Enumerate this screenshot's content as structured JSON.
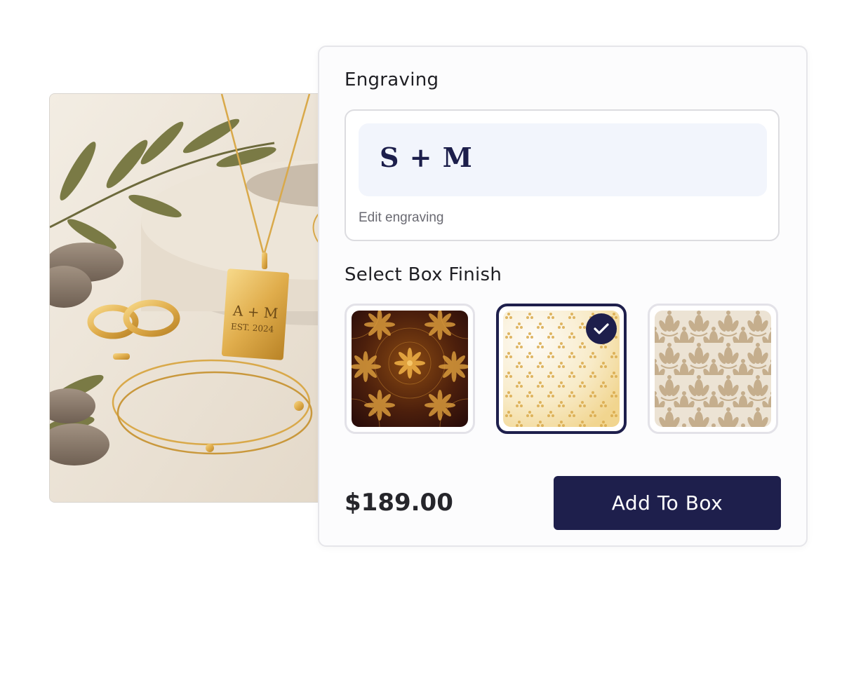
{
  "product_photo": {
    "pendant_line1": "A + M",
    "pendant_line2": "EST. 2024"
  },
  "engraving": {
    "title": "Engraving",
    "preview_text": "S + M",
    "edit_label": "Edit engraving"
  },
  "box_finish": {
    "title": "Select Box Finish",
    "options": [
      {
        "name": "dark bronze floral",
        "selected": false
      },
      {
        "name": "cream gold trefoil",
        "selected": true
      },
      {
        "name": "beige damask",
        "selected": false
      }
    ]
  },
  "price": "$189.00",
  "add_button_label": "Add To Box",
  "colors": {
    "accent": "#1e1f4c",
    "preview_bg": "#f2f5fc",
    "gold": "#d9a94a"
  },
  "icons": {
    "check": "check-icon"
  }
}
